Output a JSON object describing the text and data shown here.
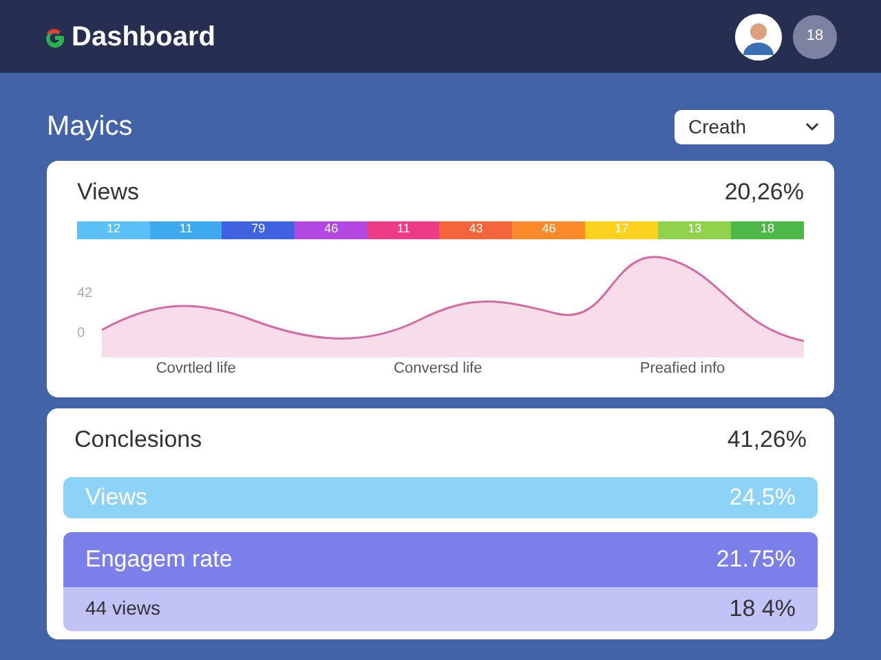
{
  "header": {
    "title": "Dashboard",
    "badge": "18"
  },
  "section": {
    "title": "Mayics",
    "dropdown": {
      "value": "Creath"
    }
  },
  "views_card": {
    "title": "Views",
    "value": "20,26%",
    "segments": [
      {
        "label": "12",
        "color": "#5bc0f5"
      },
      {
        "label": "11",
        "color": "#3fa9f0"
      },
      {
        "label": "79",
        "color": "#3f63e0"
      },
      {
        "label": "46",
        "color": "#b349e0"
      },
      {
        "label": "11",
        "color": "#ee3b86"
      },
      {
        "label": "43",
        "color": "#f5643a"
      },
      {
        "label": "46",
        "color": "#fa8a2a"
      },
      {
        "label": "17",
        "color": "#fdd21e"
      },
      {
        "label": "13",
        "color": "#90d24c"
      },
      {
        "label": "18",
        "color": "#4cb848"
      }
    ],
    "y_labels": [
      "42",
      "0"
    ],
    "x_labels": [
      "Covrtled life",
      "Conversd life",
      "Preafied info"
    ]
  },
  "conclusions_card": {
    "title": "Conclesions",
    "value": "41,26%",
    "rows": [
      {
        "kind": "wave",
        "label": "Views",
        "value": "24.5%"
      },
      {
        "kind": "strong",
        "label": "Engagem rate",
        "value": "21.75%"
      },
      {
        "kind": "light",
        "label": "44 views",
        "value": "18 4%"
      }
    ]
  }
}
